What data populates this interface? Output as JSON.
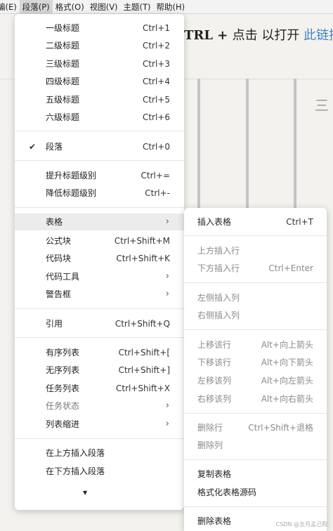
{
  "menubar": [
    {
      "label": "编(E)"
    },
    {
      "label": "段落(P)"
    },
    {
      "label": "格式(O)"
    },
    {
      "label": "视图(V)"
    },
    {
      "label": "主题(T)"
    },
    {
      "label": "帮助(H)"
    }
  ],
  "document": {
    "bold_text": "TRL + ",
    "plain_text": "点击 以打开 ",
    "link_text": "此链接",
    "heading_fragment": "三"
  },
  "paragraph_menu": {
    "headings": [
      {
        "label": "一级标题",
        "shortcut": "Ctrl+1"
      },
      {
        "label": "二级标题",
        "shortcut": "Ctrl+2"
      },
      {
        "label": "三级标题",
        "shortcut": "Ctrl+3"
      },
      {
        "label": "四级标题",
        "shortcut": "Ctrl+4"
      },
      {
        "label": "五级标题",
        "shortcut": "Ctrl+5"
      },
      {
        "label": "六级标题",
        "shortcut": "Ctrl+6"
      }
    ],
    "paragraph": {
      "label": "段落",
      "shortcut": "Ctrl+0",
      "checked": true
    },
    "levels": [
      {
        "label": "提升标题级别",
        "shortcut": "Ctrl+="
      },
      {
        "label": "降低标题级别",
        "shortcut": "Ctrl+-"
      }
    ],
    "blocks": [
      {
        "label": "表格"
      },
      {
        "label": "公式块",
        "shortcut": "Ctrl+Shift+M"
      },
      {
        "label": "代码块",
        "shortcut": "Ctrl+Shift+K"
      },
      {
        "label": "代码工具"
      },
      {
        "label": "警告框"
      }
    ],
    "quote": {
      "label": "引用",
      "shortcut": "Ctrl+Shift+Q"
    },
    "lists": [
      {
        "label": "有序列表",
        "shortcut": "Ctrl+Shift+["
      },
      {
        "label": "无序列表",
        "shortcut": "Ctrl+Shift+]"
      },
      {
        "label": "任务列表",
        "shortcut": "Ctrl+Shift+X"
      },
      {
        "label": "任务状态"
      },
      {
        "label": "列表缩进"
      }
    ],
    "insert": [
      {
        "label": "在上方插入段落"
      },
      {
        "label": "在下方插入段落"
      }
    ]
  },
  "table_submenu": {
    "insert_table": {
      "label": "插入表格",
      "shortcut": "Ctrl+T"
    },
    "rows": [
      {
        "label": "上方插入行"
      },
      {
        "label": "下方插入行",
        "shortcut": "Ctrl+Enter"
      }
    ],
    "cols": [
      {
        "label": "左侧插入列"
      },
      {
        "label": "右侧插入列"
      }
    ],
    "moves": [
      {
        "label": "上移该行",
        "shortcut": "Alt+向上箭头"
      },
      {
        "label": "下移该行",
        "shortcut": "Alt+向下箭头"
      },
      {
        "label": "左移该列",
        "shortcut": "Alt+向左箭头"
      },
      {
        "label": "右移该列",
        "shortcut": "Alt+向右箭头"
      }
    ],
    "deletes": [
      {
        "label": "删除行",
        "shortcut": "Ctrl+Shift+退格"
      },
      {
        "label": "删除列"
      }
    ],
    "misc": [
      {
        "label": "复制表格"
      },
      {
        "label": "格式化表格源码"
      }
    ],
    "delete_table": {
      "label": "删除表格"
    }
  },
  "icons": {
    "check": "✔",
    "submenu_arrow": "›",
    "more": "▼"
  },
  "watermark": "CSDN @五月孟己阳"
}
